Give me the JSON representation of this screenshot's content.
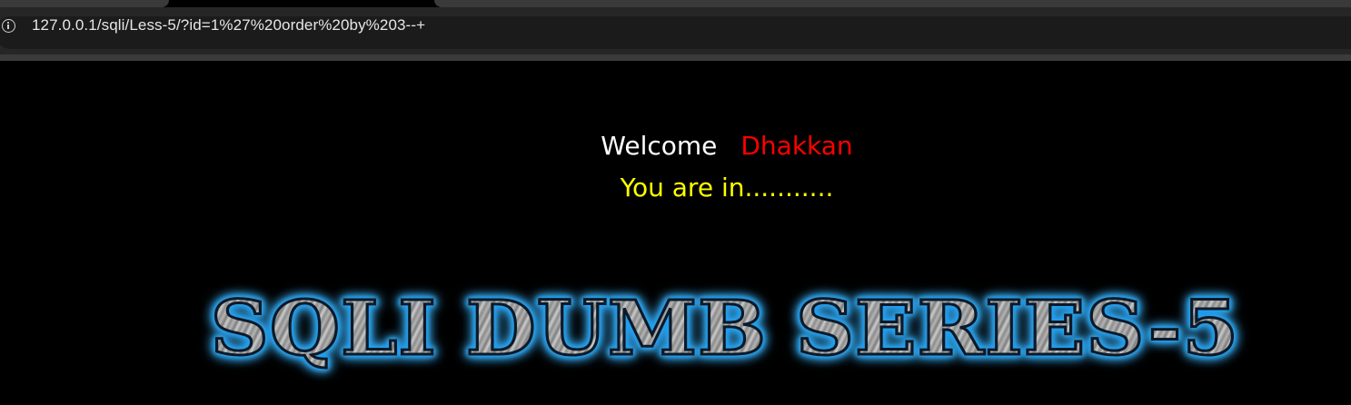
{
  "browser": {
    "url": "127.0.0.1/sqli/Less-5/?id=1%27%20order%20by%203--+",
    "site_info_icon": "info-icon"
  },
  "page": {
    "welcome_word": "Welcome",
    "user_name": "Dhakkan",
    "status": "You are in...........",
    "banner_title": "SQLI DUMB SERIES-5"
  },
  "colors": {
    "background": "#000000",
    "welcome_word": "#ffffff",
    "user_name": "#ff0000",
    "status": "#ffff00",
    "banner_glow": "#1aa6ff"
  }
}
